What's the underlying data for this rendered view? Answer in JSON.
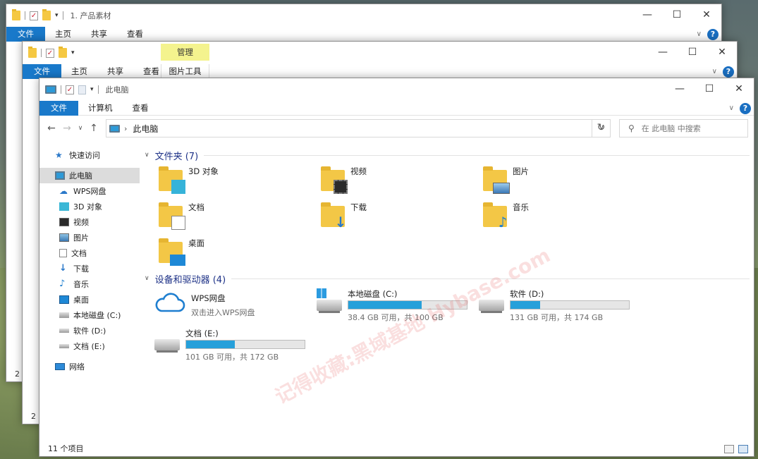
{
  "back_window_1": {
    "title": "1. 产品素材",
    "tabs": [
      "文件",
      "主页",
      "共享",
      "查看"
    ],
    "status_digit": "2"
  },
  "back_window_2": {
    "context_tab": "管理",
    "tabs": [
      "文件",
      "主页",
      "共享",
      "查看",
      "图片工具"
    ],
    "status_digit": "2 -"
  },
  "window": {
    "title": "此电脑",
    "caption": {
      "minimize": "—",
      "maximize": "☐",
      "close": "✕"
    },
    "tabs": [
      "文件",
      "计算机",
      "查看"
    ],
    "help": "?",
    "address": "此电脑",
    "search_placeholder": "在 此电脑 中搜索",
    "status": "11 个项目"
  },
  "sidebar": {
    "quick_access": "快速访问",
    "this_pc": "此电脑",
    "items": [
      "WPS网盘",
      "3D 对象",
      "视频",
      "图片",
      "文档",
      "下载",
      "音乐",
      "桌面",
      "本地磁盘 (C:)",
      "软件 (D:)",
      "文档 (E:)"
    ],
    "network": "网络"
  },
  "folders": {
    "header": "文件夹 (7)",
    "items": [
      "3D 对象",
      "视频",
      "图片",
      "文档",
      "下载",
      "音乐",
      "桌面"
    ]
  },
  "devices": {
    "header": "设备和驱动器 (4)",
    "wps": {
      "name": "WPS网盘",
      "sub": "双击进入WPS网盘"
    },
    "drives": [
      {
        "name": "本地磁盘 (C:)",
        "free": "38.4 GB 可用，共 100 GB",
        "used_fraction": 0.62
      },
      {
        "name": "软件 (D:)",
        "free": "131 GB 可用，共 174 GB",
        "used_fraction": 0.25
      },
      {
        "name": "文档 (E:)",
        "free": "101 GB 可用，共 172 GB",
        "used_fraction": 0.41
      }
    ]
  },
  "watermark": "记得收藏:黑域基地 Hybase.com",
  "colors": {
    "accent": "#1979ca",
    "drive_bar": "#26a0da",
    "section_header": "#1e3287",
    "context_tab": "#f4f38e"
  }
}
